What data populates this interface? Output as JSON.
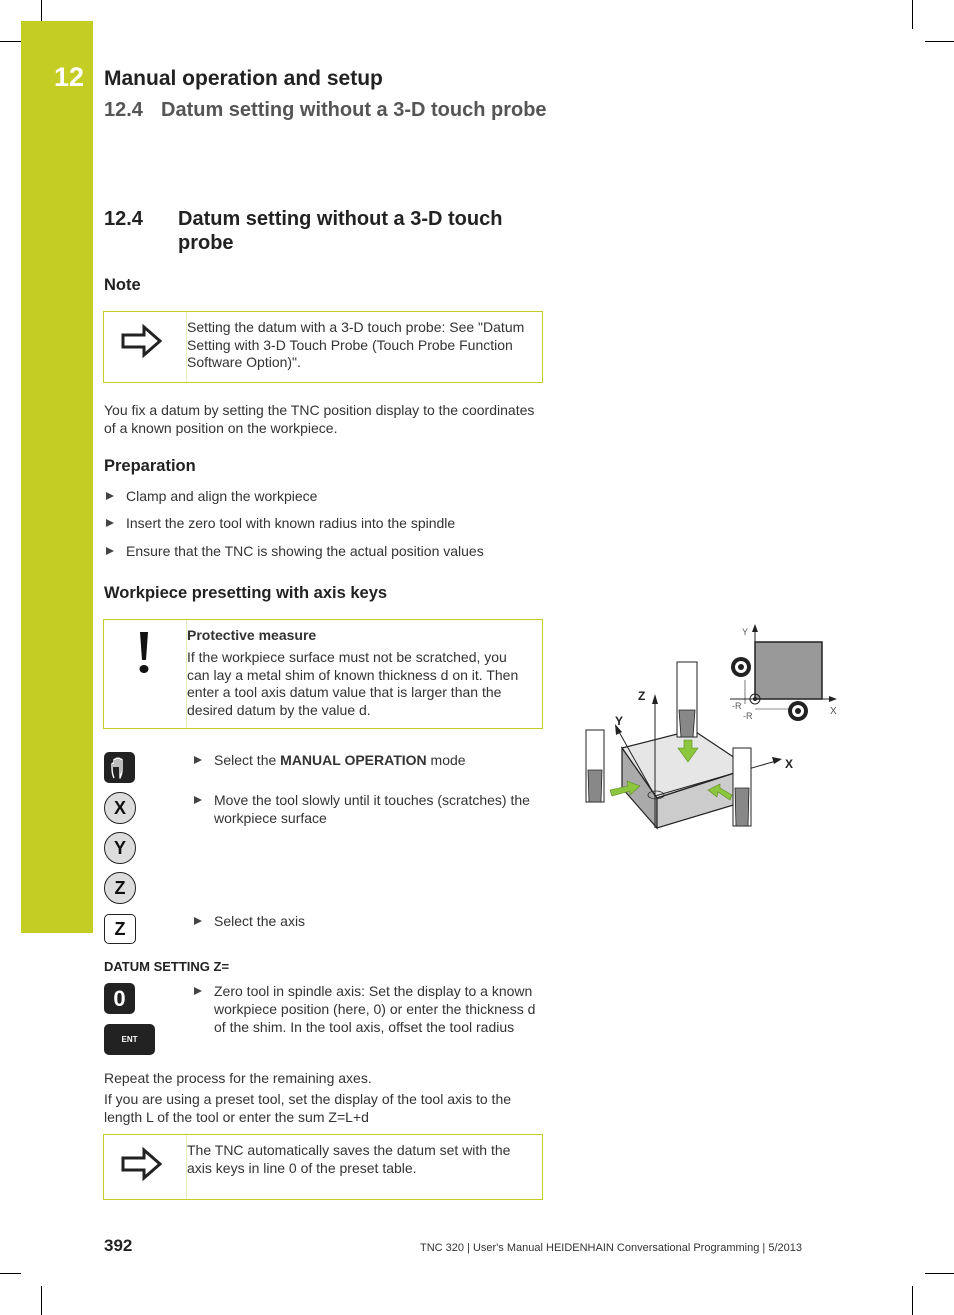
{
  "header": {
    "chapter_number": "12",
    "chapter_title": "Manual operation and setup",
    "section_number": "12.4",
    "section_title": "Datum setting without a 3-D touch probe"
  },
  "section": {
    "number": "12.4",
    "title": "Datum setting without a 3-D touch probe"
  },
  "note": {
    "heading": "Note",
    "icon": "arrow-right-icon",
    "text": "Setting the datum with a 3-D touch probe: See \"Datum Setting with 3-D Touch Probe (Touch Probe Function Software Option)\"."
  },
  "intro": "You fix a datum by setting the TNC position display to the coordinates of a known position on the workpiece.",
  "preparation": {
    "heading": "Preparation",
    "items": [
      "Clamp and align the workpiece",
      "Insert the zero tool with known radius into the spindle",
      "Ensure that the TNC is showing the actual position values"
    ]
  },
  "presetting": {
    "heading": "Workpiece presetting with axis keys",
    "warning": {
      "icon": "exclamation-icon",
      "title": "Protective measure",
      "text": "If the workpiece surface must not be scratched, you can lay a metal shim of known thickness d on it. Then enter a tool axis datum value that is larger than the desired datum by the value d."
    },
    "steps": [
      {
        "prefix": "Select the ",
        "bold": "MANUAL OPERATION",
        "suffix": " mode"
      },
      {
        "text": "Move the tool slowly until it touches (scratches) the workpiece surface"
      },
      {
        "text": "Select the axis"
      }
    ],
    "keys": {
      "manual": "hand-icon",
      "x": "X",
      "y": "Y",
      "z": "Z",
      "z_axis": "Z",
      "zero": "0",
      "ent": "ENT"
    },
    "dialog_label": "DATUM SETTING Z=",
    "zero_step": "Zero tool in spindle axis: Set the display to a known workpiece position (here, 0) or enter the thickness d of the shim. In the tool axis, offset the tool radius",
    "repeat_text": "Repeat the process for the remaining axes.",
    "preset_text": "If you are using a preset tool, set the display of the tool axis to the length L of the tool or enter the sum Z=L+d"
  },
  "figure": {
    "labels": {
      "z": "Z",
      "y": "Y",
      "x": "X",
      "inset_y": "Y",
      "inset_x": "X",
      "minus_r1": "-R",
      "minus_r2": "-R"
    }
  },
  "final_note": {
    "icon": "arrow-right-icon",
    "text": "The TNC automatically saves the datum set with the axis keys in line 0 of the preset table."
  },
  "footer": {
    "page_number": "392",
    "text": "TNC 320 | User's Manual HEIDENHAIN Conversational Programming | 5/2013"
  },
  "colors": {
    "accent": "#c3cd23",
    "arrow_green": "#8cc63f"
  }
}
